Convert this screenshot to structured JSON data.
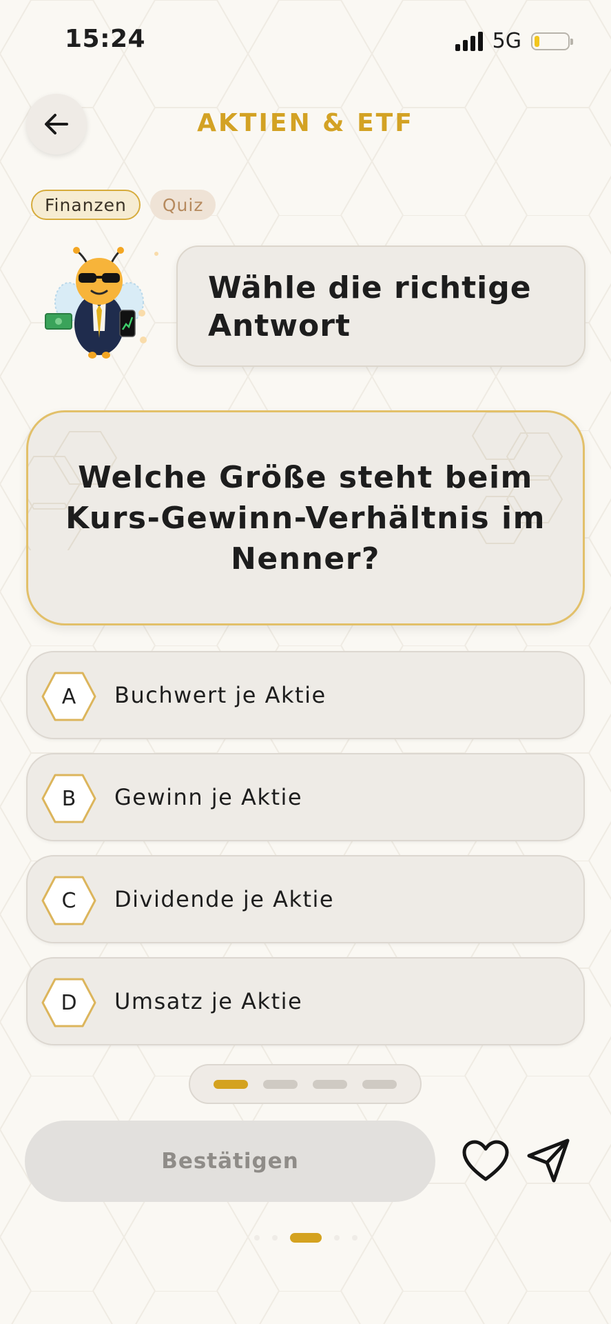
{
  "status_bar": {
    "time": "15:24",
    "network": "5G",
    "signal_bars": 4,
    "battery_level": 0.15
  },
  "header": {
    "title": "AKTIEN & ETF",
    "back_icon": "arrow-left-icon"
  },
  "tags": [
    "Finanzen",
    "Quiz"
  ],
  "instruction": "Wähle die richtige Antwort",
  "question": "Welche Größe steht beim Kurs-Gewinn-Verhältnis im Nenner?",
  "answers": [
    {
      "letter": "A",
      "text": "Buchwert je Aktie"
    },
    {
      "letter": "B",
      "text": "Gewinn je Aktie"
    },
    {
      "letter": "C",
      "text": "Dividende je Aktie"
    },
    {
      "letter": "D",
      "text": "Umsatz je Aktie"
    }
  ],
  "progress": {
    "total": 4,
    "current": 1
  },
  "confirm_label": "Bestätigen",
  "actions": {
    "like_icon": "heart-icon",
    "share_icon": "send-icon"
  },
  "pager": {
    "total": 5,
    "current": 3
  },
  "colors": {
    "accent": "#d4a21f",
    "background": "#faf8f3",
    "card": "#eeebe6",
    "card_border": "#e2c06a"
  }
}
